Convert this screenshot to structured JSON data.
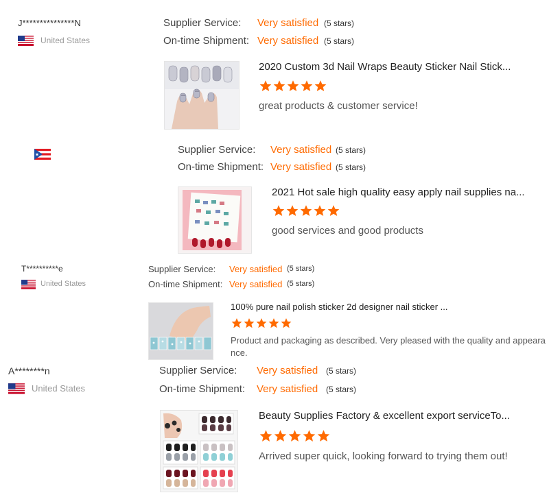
{
  "colors": {
    "accent": "#ff6a00",
    "label": "#444444",
    "muted": "#999999"
  },
  "reviews": [
    {
      "buyer": "J***************N",
      "country": "United States",
      "flag": "us-flag-icon",
      "supplier_label": "Supplier Service:",
      "supplier_value": "Very satisfied",
      "supplier_stars": "(5 stars)",
      "shipment_label": "On-time Shipment:",
      "shipment_value": "Very satisfied",
      "shipment_stars": "(5 stars)",
      "product_title": "2020 Custom 3d Nail Wraps Beauty Sticker Nail Stick...",
      "rating": 5,
      "text": "great products & customer service!"
    },
    {
      "flag": "puerto-rico-flag-icon",
      "supplier_label": "Supplier Service:",
      "supplier_value": "Very satisfied",
      "supplier_stars": "(5 stars)",
      "shipment_label": "On-time Shipment:",
      "shipment_value": "Very satisfied",
      "shipment_stars": "(5 stars)",
      "product_title": "2021 Hot sale high quality easy apply nail supplies na...",
      "rating": 5,
      "text": "good services and good products"
    },
    {
      "buyer": "T**********e",
      "country": "United States",
      "flag": "us-flag-icon",
      "supplier_label": "Supplier Service:",
      "supplier_value": "Very satisfied",
      "supplier_stars": "(5 stars)",
      "shipment_label": "On-time Shipment:",
      "shipment_value": "Very satisfied",
      "shipment_stars": "(5 stars)",
      "product_title": "100% pure nail polish sticker 2d designer nail sticker ...",
      "rating": 5,
      "text": "Product and packaging as described. Very pleased with the quality and appearance."
    },
    {
      "buyer": "A********n",
      "country": "United States",
      "flag": "us-flag-icon",
      "supplier_label": "Supplier Service:",
      "supplier_value": "Very satisfied",
      "supplier_stars": "(5 stars)",
      "shipment_label": "On-time Shipment:",
      "shipment_value": "Very satisfied",
      "shipment_stars": "(5 stars)",
      "product_title": "Beauty Supplies Factory & excellent export serviceTo...",
      "rating": 5,
      "text": "Arrived super quick, looking forward to trying them out!"
    }
  ]
}
